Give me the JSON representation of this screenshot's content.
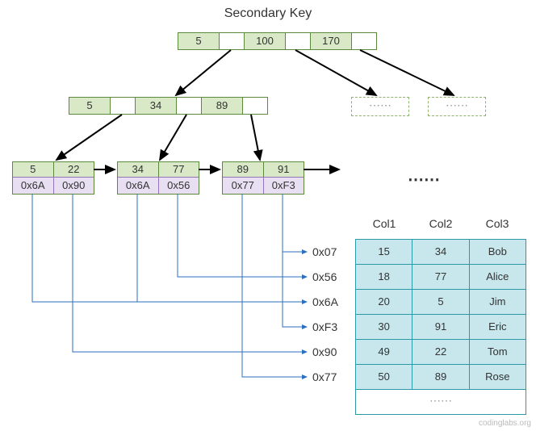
{
  "title": "Secondary Key",
  "root": {
    "keys": [
      "5",
      "100",
      "170"
    ]
  },
  "internal": {
    "keys": [
      "5",
      "34",
      "89"
    ]
  },
  "leaves": [
    {
      "keys": [
        "5",
        "22"
      ],
      "ptrs": [
        "0x6A",
        "0x90"
      ]
    },
    {
      "keys": [
        "34",
        "77"
      ],
      "ptrs": [
        "0x6A",
        "0x56"
      ]
    },
    {
      "keys": [
        "89",
        "91"
      ],
      "ptrs": [
        "0x77",
        "0xF3"
      ]
    }
  ],
  "ghost_ellipsis": "⋯⋯",
  "leaf_ellipsis": "⋯⋯",
  "address_labels": [
    "0x07",
    "0x56",
    "0x6A",
    "0xF3",
    "0x90",
    "0x77"
  ],
  "table": {
    "columns": [
      "Col1",
      "Col2",
      "Col3"
    ],
    "rows": [
      {
        "col1": "15",
        "col2": "34",
        "col3": "Bob"
      },
      {
        "col1": "18",
        "col2": "77",
        "col3": "Alice"
      },
      {
        "col1": "20",
        "col2": "5",
        "col3": "Jim"
      },
      {
        "col1": "30",
        "col2": "91",
        "col3": "Eric"
      },
      {
        "col1": "49",
        "col2": "22",
        "col3": "Tom"
      },
      {
        "col1": "50",
        "col2": "89",
        "col3": "Rose"
      }
    ],
    "footer": "⋯⋯"
  },
  "watermark": "codinglabs.org",
  "chart_data": {
    "type": "tree",
    "description": "B+tree secondary index structure with leaf nodes containing record pointers to a table",
    "root_keys": [
      5,
      100,
      170
    ],
    "internal_keys": [
      5,
      34,
      89
    ],
    "leaf_nodes": [
      {
        "keys": [
          5,
          22
        ],
        "pointers": [
          "0x6A",
          "0x90"
        ]
      },
      {
        "keys": [
          34,
          77
        ],
        "pointers": [
          "0x6A",
          "0x56"
        ]
      },
      {
        "keys": [
          89,
          91
        ],
        "pointers": [
          "0x77",
          "0xF3"
        ]
      }
    ],
    "record_addresses": [
      "0x07",
      "0x56",
      "0x6A",
      "0xF3",
      "0x90",
      "0x77"
    ],
    "table": {
      "columns": [
        "Col1",
        "Col2",
        "Col3"
      ],
      "rows": [
        [
          15,
          34,
          "Bob"
        ],
        [
          18,
          77,
          "Alice"
        ],
        [
          20,
          5,
          "Jim"
        ],
        [
          30,
          91,
          "Eric"
        ],
        [
          49,
          22,
          "Tom"
        ],
        [
          50,
          89,
          "Rose"
        ]
      ]
    }
  }
}
